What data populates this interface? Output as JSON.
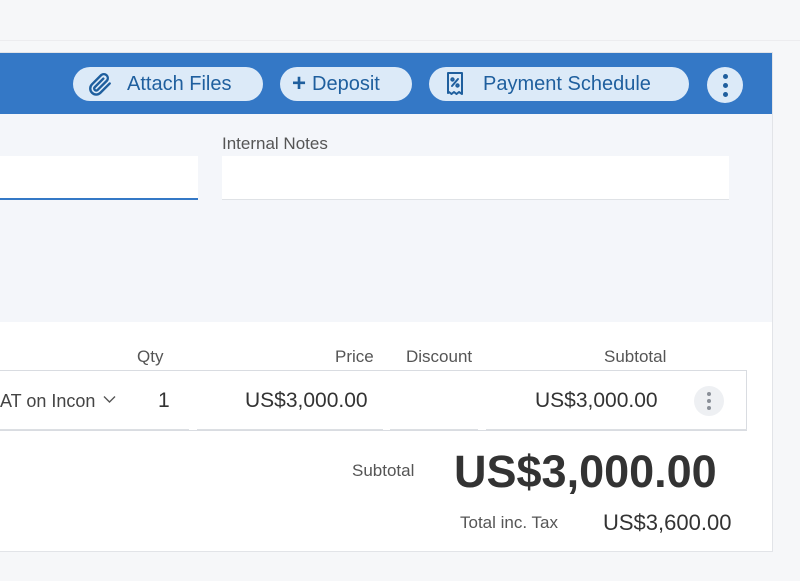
{
  "toolbar": {
    "attach_label": "Attach Files",
    "deposit_label": "Deposit",
    "deposit_prefix": "+",
    "schedule_label": "Payment Schedule",
    "icons": {
      "attach": "paperclip-icon",
      "schedule": "receipt-percent-icon",
      "more": "kebab-vertical-icon"
    }
  },
  "notes": {
    "label": "Internal Notes",
    "value": "",
    "left_field_value": ""
  },
  "table": {
    "headers": {
      "qty": "Qty",
      "price": "Price",
      "discount": "Discount",
      "subtotal": "Subtotal"
    },
    "rows": [
      {
        "tax": "AT on Incon",
        "qty": "1",
        "price": "US$3,000.00",
        "discount": "",
        "subtotal": "US$3,000.00"
      }
    ]
  },
  "summary": {
    "subtotal_label": "Subtotal",
    "subtotal_value": "US$3,000.00",
    "total_label": "Total inc. Tax",
    "total_value": "US$3,600.00"
  },
  "colors": {
    "toolbar": "#3478c6",
    "pill_bg": "#dceaf8",
    "pill_text": "#1f5f9e"
  }
}
